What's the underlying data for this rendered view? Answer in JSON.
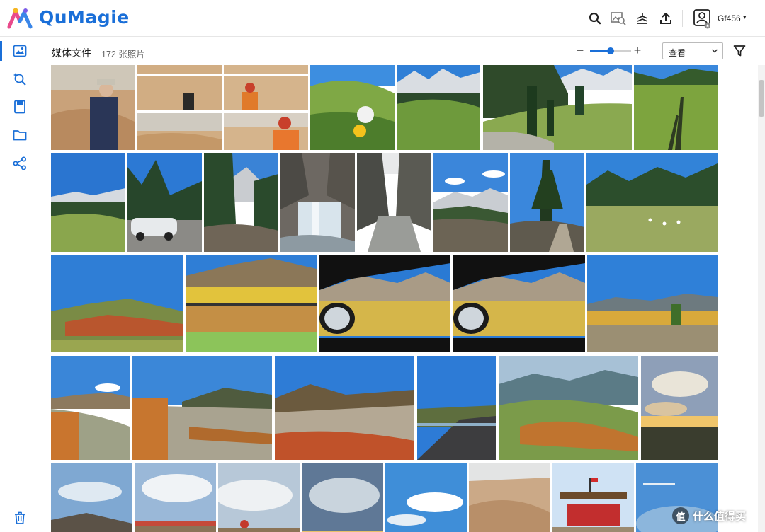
{
  "app": {
    "brand": "QuMagie",
    "brand_color": "#1a6fd8"
  },
  "header": {
    "icons": [
      "search-icon",
      "image-search-icon",
      "stack-icon",
      "upload-icon"
    ],
    "user": {
      "name": "Gf456",
      "caret": "▾"
    }
  },
  "sidebar": {
    "items": [
      "photos-icon",
      "smart-album-icon",
      "album-icon",
      "folder-icon",
      "share-icon"
    ],
    "bottom": "trash-icon",
    "active": 0
  },
  "toolbar": {
    "title": "媒体文件",
    "count": "172 张照片",
    "zoom_minus": "−",
    "zoom_plus": "+",
    "zoom_level": 0.5,
    "view_label": "查看",
    "filter": "filter-icon"
  },
  "watermark": {
    "badge": "值",
    "text": "什么值得买"
  }
}
